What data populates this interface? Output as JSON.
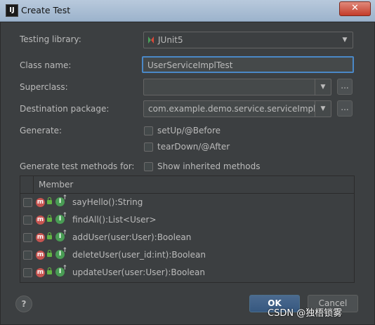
{
  "window": {
    "title": "Create Test",
    "app_icon": "IJ",
    "close_label": "✕"
  },
  "form": {
    "testing_library": {
      "label": "Testing library:",
      "value": "JUnit5"
    },
    "class_name": {
      "label": "Class name:",
      "value": "UserServiceImplTest"
    },
    "superclass": {
      "label": "Superclass:",
      "value": ""
    },
    "destination_package": {
      "label": "Destination package:",
      "value": "com.example.demo.service.serviceImpl"
    },
    "browse_label": "...",
    "generate": {
      "label": "Generate:",
      "options": [
        {
          "label": "setUp/@Before",
          "checked": false
        },
        {
          "label": "tearDown/@After",
          "checked": false
        }
      ]
    },
    "generate_methods_label": "Generate test methods for:",
    "show_inherited": {
      "label": "Show inherited methods",
      "checked": false
    }
  },
  "table": {
    "header": "Member",
    "rows": [
      {
        "method": "sayHello():String",
        "checked": false
      },
      {
        "method": "findAll():List<User>",
        "checked": false
      },
      {
        "method": "addUser(user:User):Boolean",
        "checked": false
      },
      {
        "method": "deleteUser(user_id:int):Boolean",
        "checked": false
      },
      {
        "method": "updateUser(user:User):Boolean",
        "checked": false
      }
    ]
  },
  "footer": {
    "help_label": "?",
    "ok_label": "OK",
    "cancel_label": "Cancel"
  },
  "watermark": "CSDN @独梧锁雾",
  "icons": {
    "method": "m",
    "implementing": "I"
  },
  "colors": {
    "background": "#3c3f41",
    "accent": "#4b6a8f",
    "method_icon": "#c75450",
    "implements_icon": "#499c54"
  }
}
